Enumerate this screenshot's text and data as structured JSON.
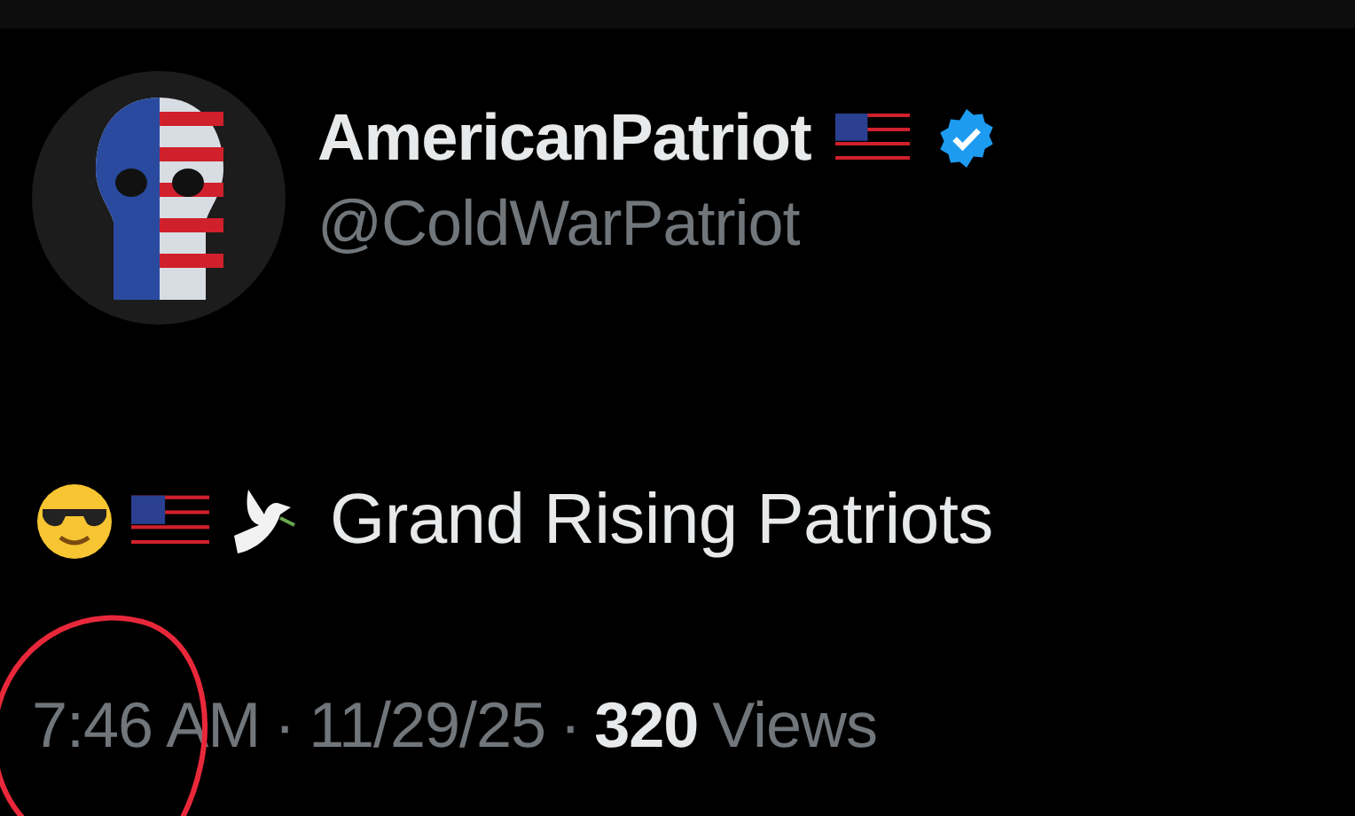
{
  "author": {
    "name": "AmericanPatriot",
    "handle": "@ColdWarPatriot",
    "verified": true
  },
  "post": {
    "text": "Grand Rising Patriots"
  },
  "meta": {
    "time": "7:46 AM",
    "separator_1": "·",
    "date": "11/29/25",
    "separator_2": "·",
    "views_count": "320",
    "views_label": "Views"
  }
}
